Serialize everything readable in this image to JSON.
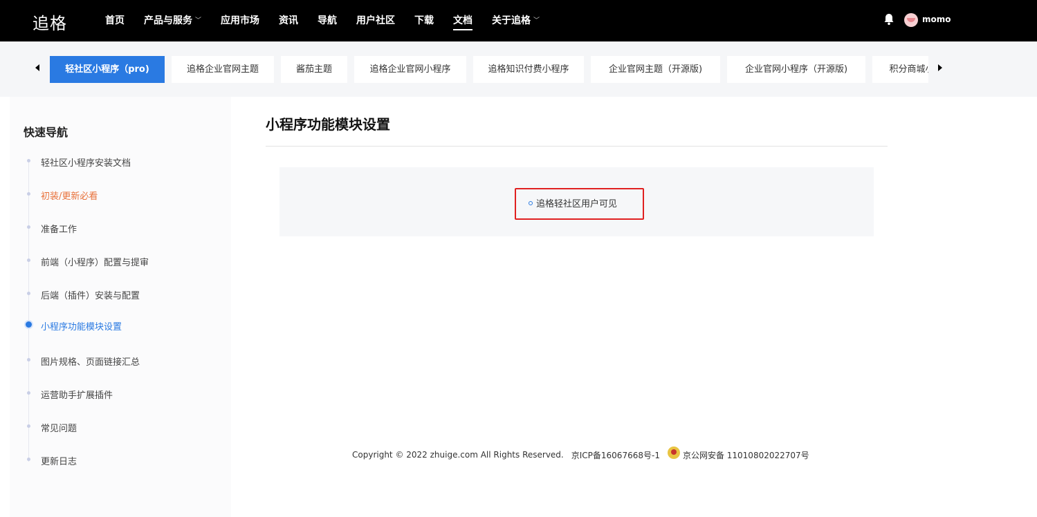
{
  "header": {
    "logo_text": "追格",
    "nav": [
      {
        "label": "首页",
        "has_dropdown": false,
        "active": false
      },
      {
        "label": "产品与服务",
        "has_dropdown": true,
        "active": false
      },
      {
        "label": "应用市场",
        "has_dropdown": false,
        "active": false
      },
      {
        "label": "资讯",
        "has_dropdown": false,
        "active": false
      },
      {
        "label": "导航",
        "has_dropdown": false,
        "active": false
      },
      {
        "label": "用户社区",
        "has_dropdown": false,
        "active": false
      },
      {
        "label": "下载",
        "has_dropdown": false,
        "active": false
      },
      {
        "label": "文档",
        "has_dropdown": false,
        "active": true
      },
      {
        "label": "关于追格",
        "has_dropdown": true,
        "active": false
      }
    ],
    "bell_icon": "bell-icon",
    "username": "momo"
  },
  "tabs": [
    {
      "label": "轻社区小程序（pro)",
      "active": true
    },
    {
      "label": "追格企业官网主题",
      "active": false
    },
    {
      "label": "酱茄主题",
      "active": false
    },
    {
      "label": "追格企业官网小程序",
      "active": false
    },
    {
      "label": "追格知识付费小程序",
      "active": false
    },
    {
      "label": "企业官网主题（开源版)",
      "active": false
    },
    {
      "label": "企业官网小程序（开源版)",
      "active": false
    },
    {
      "label": "积分商城小程序",
      "active": false
    }
  ],
  "sidebar": {
    "title": "快速导航",
    "items": [
      {
        "label": "轻社区小程序安装文档",
        "state": "normal"
      },
      {
        "label": "初装/更新必看",
        "state": "orange"
      },
      {
        "label": "准备工作",
        "state": "normal"
      },
      {
        "label": "前端（小程序）配置与提审",
        "state": "normal"
      },
      {
        "label": "后端（插件）安装与配置",
        "state": "normal"
      },
      {
        "label": "小程序功能模块设置",
        "state": "current"
      },
      {
        "label": "图片规格、页面链接汇总",
        "state": "normal"
      },
      {
        "label": "运营助手扩展插件",
        "state": "normal"
      },
      {
        "label": "常见问题",
        "state": "normal"
      },
      {
        "label": "更新日志",
        "state": "normal"
      }
    ]
  },
  "main": {
    "title": "小程序功能模块设置",
    "list_item": "追格轻社区用户可见"
  },
  "footer": {
    "copyright": "Copyright © 2022 zhuige.com All Rights Reserved.",
    "icp": "京ICP备16067668号-1",
    "police": "京公网安备 11010802022707号"
  },
  "colors": {
    "accent": "#2a7ae2",
    "orange": "#e8713a",
    "highlight_border": "#e02020",
    "topbar": "#000000"
  }
}
